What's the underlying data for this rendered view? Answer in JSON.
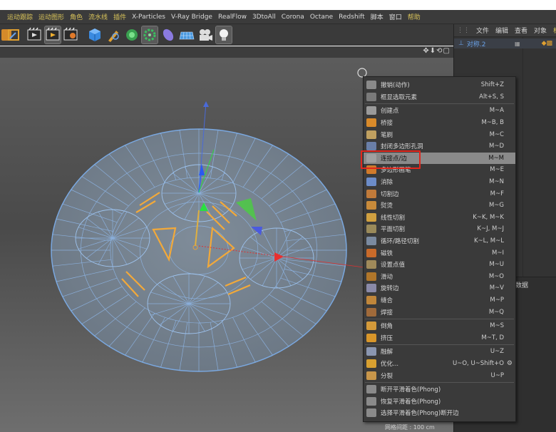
{
  "menubar": [
    {
      "label": "运动跟踪",
      "tone": "yellow"
    },
    {
      "label": "运动图形",
      "tone": "yellow"
    },
    {
      "label": "角色",
      "tone": "yellow"
    },
    {
      "label": "流水线",
      "tone": "yellow"
    },
    {
      "label": "插件",
      "tone": "yellow"
    },
    {
      "label": "X-Particles",
      "tone": "white"
    },
    {
      "label": "V-Ray Bridge",
      "tone": "white"
    },
    {
      "label": "RealFlow",
      "tone": "white"
    },
    {
      "label": "3DtoAll",
      "tone": "white"
    },
    {
      "label": "Corona",
      "tone": "white"
    },
    {
      "label": "Octane",
      "tone": "white"
    },
    {
      "label": "Redshift",
      "tone": "white"
    },
    {
      "label": "脚本",
      "tone": "white"
    },
    {
      "label": "窗口",
      "tone": "white"
    },
    {
      "label": "帮助",
      "tone": "yellow"
    }
  ],
  "right_panel": {
    "tabs": [
      "文件",
      "编辑",
      "查看",
      "对象",
      "标签"
    ],
    "object_name": "对称.2",
    "lower_label": "数据"
  },
  "context_menu": {
    "items": [
      {
        "label": "撤销(动作)",
        "shortcut": "Shift+Z",
        "icon": "undo-icon",
        "color": "#8a8a8a"
      },
      {
        "label": "框显选取元素",
        "shortcut": "Alt+S, S",
        "icon": "frame-selection-icon",
        "color": "#7a7a7a"
      },
      {
        "label": "创建点",
        "shortcut": "M~A",
        "icon": "create-point-icon",
        "color": "#9a9a9a",
        "sep_before": true
      },
      {
        "label": "桥接",
        "shortcut": "M~B, B",
        "icon": "bridge-icon",
        "color": "#d88a2a"
      },
      {
        "label": "笔刷",
        "shortcut": "M~C",
        "icon": "brush-icon",
        "color": "#c0a060"
      },
      {
        "label": "封闭多边形孔洞",
        "shortcut": "M~D",
        "icon": "close-hole-icon",
        "color": "#6a7fa8"
      },
      {
        "label": "连接点/边",
        "shortcut": "M~M",
        "icon": "connect-points-edges-icon",
        "color": "#a0a0a0",
        "highlighted": true
      },
      {
        "label": "多边形画笔",
        "shortcut": "M~E",
        "icon": "polygon-pen-icon",
        "color": "#d07a2a"
      },
      {
        "label": "消除",
        "shortcut": "M~N",
        "icon": "dissolve-icon",
        "color": "#6c8cc8"
      },
      {
        "label": "切割边",
        "shortcut": "M~F",
        "icon": "edge-cut-icon",
        "color": "#c07a3a"
      },
      {
        "label": "熨烫",
        "shortcut": "M~G",
        "icon": "iron-icon",
        "color": "#c88a3a"
      },
      {
        "label": "线性切割",
        "shortcut": "K~K, M~K",
        "icon": "line-cut-icon",
        "color": "#d0a040"
      },
      {
        "label": "平面切割",
        "shortcut": "K~J, M~J",
        "icon": "plane-cut-icon",
        "color": "#9a8a5a"
      },
      {
        "label": "循环/路径切割",
        "shortcut": "K~L, M~L",
        "icon": "loop-path-cut-icon",
        "color": "#7a8aa0"
      },
      {
        "label": "磁铁",
        "shortcut": "M~I",
        "icon": "magnet-icon",
        "color": "#c86a2a"
      },
      {
        "label": "设置点值",
        "shortcut": "M~U",
        "icon": "set-point-value-icon",
        "color": "#a08a5a"
      },
      {
        "label": "滑动",
        "shortcut": "M~O",
        "icon": "slide-icon",
        "color": "#b0762a"
      },
      {
        "label": "旋转边",
        "shortcut": "M~V",
        "icon": "spin-edge-icon",
        "color": "#8a8aa8"
      },
      {
        "label": "缝合",
        "shortcut": "M~P",
        "icon": "stitch-icon",
        "color": "#c0863a"
      },
      {
        "label": "焊接",
        "shortcut": "M~Q",
        "icon": "weld-icon",
        "color": "#a06a3a"
      },
      {
        "label": "倒角",
        "shortcut": "M~S",
        "icon": "bevel-icon",
        "color": "#d49a3a",
        "sep_before": true
      },
      {
        "label": "挤压",
        "shortcut": "M~T, D",
        "icon": "extrude-icon",
        "color": "#d8962a"
      },
      {
        "label": "融解",
        "shortcut": "U~Z",
        "icon": "melt-icon",
        "color": "#8a96b0",
        "sep_before": true
      },
      {
        "label": "优化...",
        "shortcut": "U~O, U~Shift+O",
        "icon": "optimize-icon",
        "color": "#d8a030",
        "gear": true
      },
      {
        "label": "分裂",
        "shortcut": "U~P",
        "icon": "split-icon",
        "color": "#c8964a"
      },
      {
        "label": "断开平滑着色(Phong)",
        "shortcut": "",
        "icon": "break-phong-icon",
        "color": "#8a8a8a",
        "sep_before": true
      },
      {
        "label": "恢复平滑着色(Phong)",
        "shortcut": "",
        "icon": "unbreak-phong-icon",
        "color": "#8a8a8a"
      },
      {
        "label": "选择平滑着色(Phong)断开边",
        "shortcut": "",
        "icon": "select-phong-edges-icon",
        "color": "#8a8a8a"
      }
    ]
  },
  "status": {
    "grid_spacing": "网格间距 : 100 cm"
  }
}
